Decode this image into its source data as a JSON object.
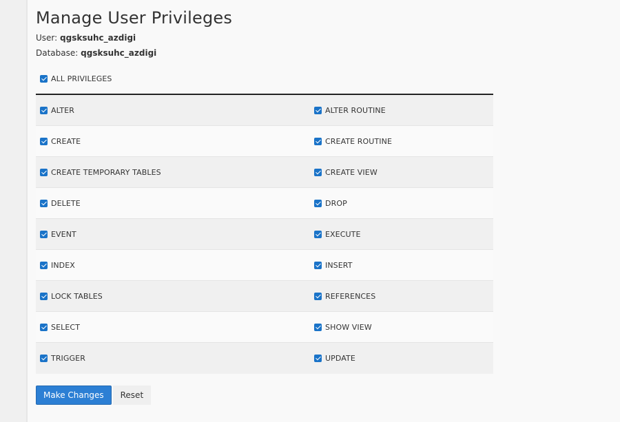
{
  "page": {
    "title": "Manage User Privileges",
    "user_label": "User:",
    "user_value": "qgsksuhc_azdigi",
    "database_label": "Database:",
    "database_value": "qgsksuhc_azdigi"
  },
  "all_privileges": {
    "label": "ALL PRIVILEGES",
    "checked": true
  },
  "privileges": [
    {
      "left": "ALTER",
      "right": "ALTER ROUTINE"
    },
    {
      "left": "CREATE",
      "right": "CREATE ROUTINE"
    },
    {
      "left": "CREATE TEMPORARY TABLES",
      "right": "CREATE VIEW"
    },
    {
      "left": "DELETE",
      "right": "DROP"
    },
    {
      "left": "EVENT",
      "right": "EXECUTE"
    },
    {
      "left": "INDEX",
      "right": "INSERT"
    },
    {
      "left": "LOCK TABLES",
      "right": "REFERENCES"
    },
    {
      "left": "SELECT",
      "right": "SHOW VIEW"
    },
    {
      "left": "TRIGGER",
      "right": "UPDATE"
    }
  ],
  "buttons": {
    "make_changes": "Make Changes",
    "reset": "Reset"
  },
  "colors": {
    "accent": "#2c7fd4",
    "checkbox": "#1a73c8"
  },
  "icons": {
    "checkbox": "checkbox-checked-icon"
  }
}
